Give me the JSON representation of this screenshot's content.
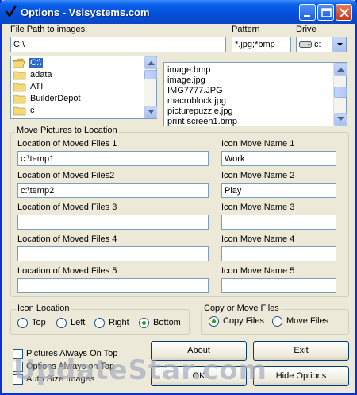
{
  "window": {
    "title": "Options - Vsisystems.com"
  },
  "top": {
    "file_path_label": "File Path to images:",
    "file_path_value": "C:\\",
    "pattern_label": "Pattern",
    "pattern_value": "*.jpg;*bmp",
    "drive_label": "Drive",
    "drive_value": "c:"
  },
  "tree": {
    "items": [
      {
        "label": "C:\\",
        "selected": true
      },
      {
        "label": "adata"
      },
      {
        "label": "ATI"
      },
      {
        "label": "BuilderDepot"
      },
      {
        "label": "c"
      }
    ]
  },
  "files": {
    "items": [
      "image.bmp",
      "image.jpg",
      "IMG7777.JPG",
      "macroblock.jpg",
      "picturepuzzle.jpg",
      "print screen1.bmp"
    ]
  },
  "move_group": {
    "title": "Move Pictures to Location",
    "rows": [
      {
        "loc_label": "Location of Moved Files 1",
        "loc_value": "c:\\temp1",
        "icon_label": "Icon Move Name 1",
        "icon_value": "Work"
      },
      {
        "loc_label": "Location of Moved Files2",
        "loc_value": "c:\\temp2",
        "icon_label": "Icon Move Name 2",
        "icon_value": "Play"
      },
      {
        "loc_label": "Location of Moved Files 3",
        "loc_value": "",
        "icon_label": "Icon Move Name 3",
        "icon_value": ""
      },
      {
        "loc_label": "Location of Moved Files 4",
        "loc_value": "",
        "icon_label": "Icon Move Name 4",
        "icon_value": ""
      },
      {
        "loc_label": "Location of Moved Files 5",
        "loc_value": "",
        "icon_label": "Icon Move Name 5",
        "icon_value": ""
      }
    ]
  },
  "icon_location": {
    "title": "Icon Location",
    "options": [
      "Top",
      "Left",
      "Right",
      "Bottom"
    ],
    "selected": "Bottom"
  },
  "copy_move": {
    "title": "Copy or Move Files",
    "options": [
      "Copy Files",
      "Move Files"
    ],
    "selected": "Copy Files"
  },
  "checkboxes": {
    "items": [
      "Pictures Always On Top",
      "Options Always on Top",
      "Auto Size Images"
    ]
  },
  "buttons": {
    "about": "About",
    "exit": "Exit",
    "ok": "OK",
    "hide_options": "Hide Options"
  },
  "watermark": "UpdateStar.com",
  "colors": {
    "titlebar": "#0a5fea",
    "selection": "#316ac5",
    "face": "#ece9d8",
    "radio_dot": "#21a121"
  }
}
